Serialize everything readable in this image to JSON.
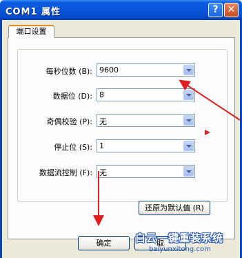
{
  "window": {
    "title": "COM1 属性",
    "help_glyph": "?",
    "close_glyph": "✕"
  },
  "tabs": [
    {
      "label": "端口设置",
      "active": true
    }
  ],
  "port_settings": [
    {
      "label": "每秒位数 (B):",
      "value": "9600"
    },
    {
      "label": "数据位 (D):",
      "value": "8"
    },
    {
      "label": "奇偶校验 (P):",
      "value": "无"
    },
    {
      "label": "停止位 (S):",
      "value": "1"
    },
    {
      "label": "数据流控制 (F):",
      "value": "无"
    }
  ],
  "buttons": {
    "restore_defaults": "还原为默认值 (R)",
    "ok": "确定",
    "cancel_partial": "取"
  },
  "watermark": {
    "text": "白云一键重装系统",
    "url": "baiyunxitong.com"
  },
  "colors": {
    "titlebar": "#0854d8",
    "dialog_bg": "#ece9d8",
    "tab_highlight": "#e68b2c",
    "annotation_arrow": "#e02020",
    "watermark": "#1a4fb0"
  },
  "icons": {
    "combo_arrow": "chevron-down-icon",
    "close": "close-icon",
    "help": "help-icon"
  }
}
